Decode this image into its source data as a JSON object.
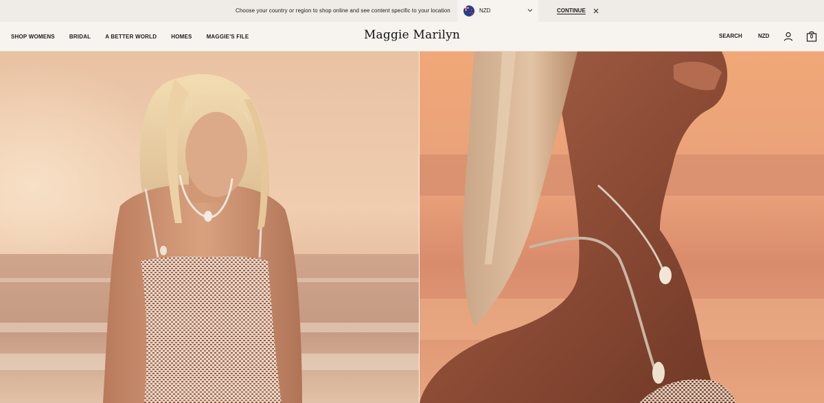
{
  "region_banner": {
    "message": "Choose your country or region to shop online and see content specific to your location",
    "selected_region": "NZD",
    "continue_label": "CONTINUE"
  },
  "header": {
    "logo": "Maggie Marilyn",
    "nav": [
      {
        "label": "SHOP WOMENS"
      },
      {
        "label": "BRIDAL"
      },
      {
        "label": "A BETTER WORLD"
      },
      {
        "label": "HOMES"
      },
      {
        "label": "MAGGIE'S FILE"
      }
    ],
    "search_label": "SEARCH",
    "currency_label": "NZD",
    "bag_count": "0"
  },
  "colors": {
    "banner_bg": "#efebe6",
    "header_bg": "#f7f4ef",
    "text": "#1a1a1a"
  },
  "icons": {
    "flag": "new-zealand-flag-icon",
    "chevron": "chevron-down-icon",
    "close": "close-icon",
    "account": "user-icon",
    "bag": "shopping-bag-icon"
  }
}
